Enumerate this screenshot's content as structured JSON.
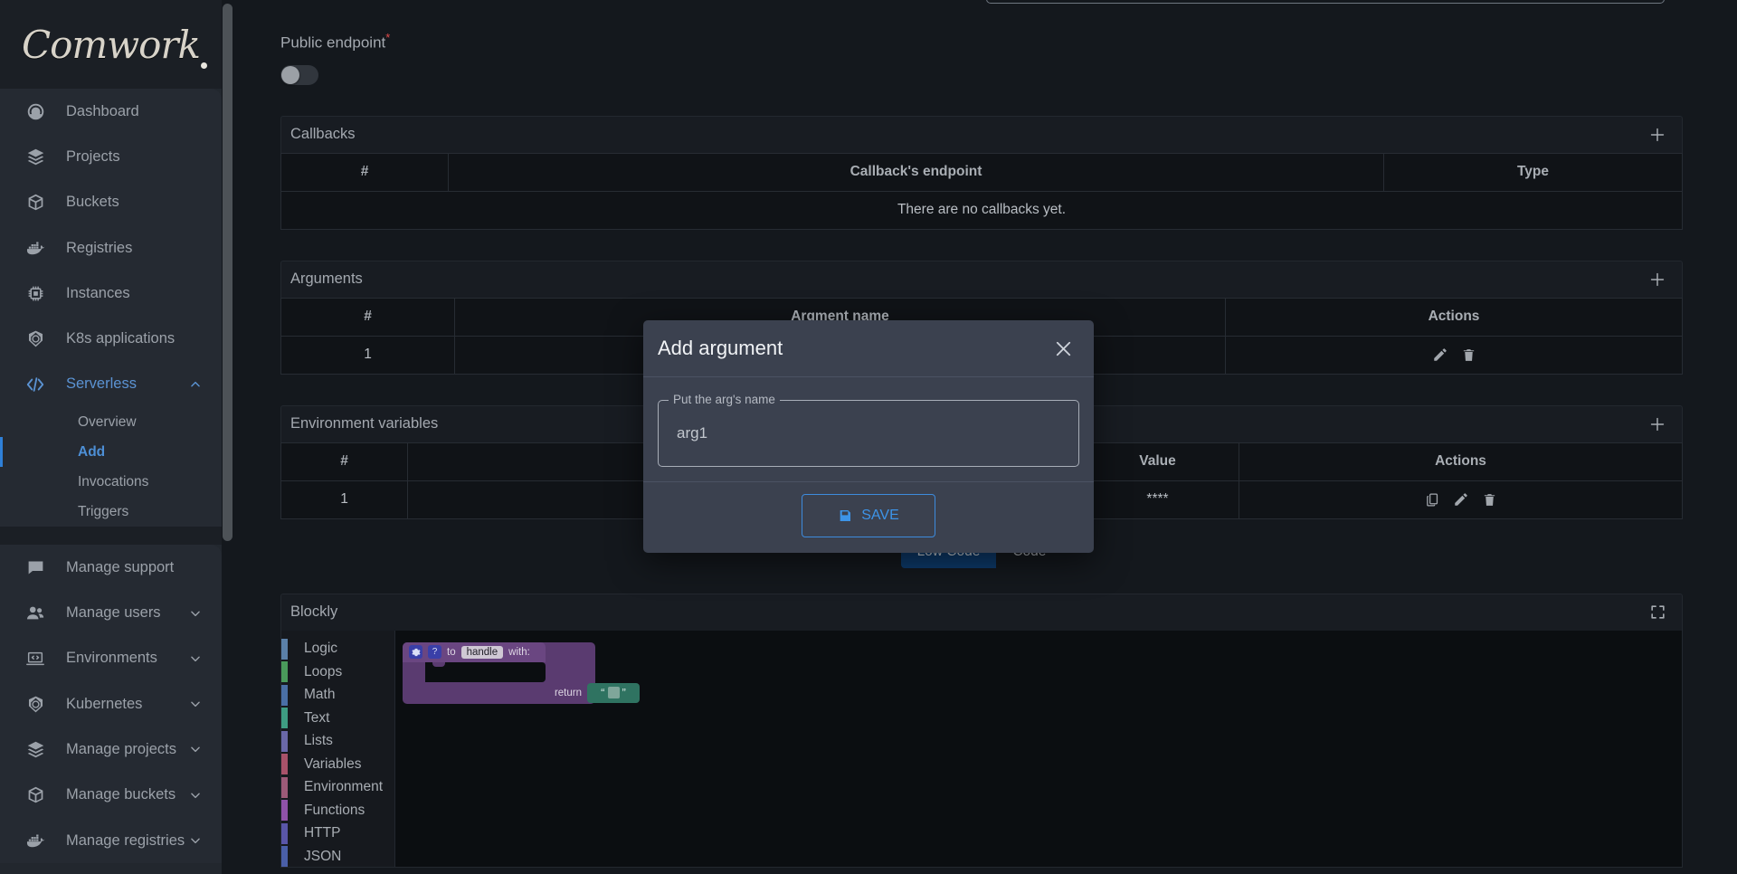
{
  "brand": {
    "name": "Comwork"
  },
  "sidebar": {
    "items": [
      {
        "label": "Dashboard",
        "icon": "gauge-icon",
        "expandable": false,
        "active": false
      },
      {
        "label": "Projects",
        "icon": "layers-icon",
        "expandable": false,
        "active": false
      },
      {
        "label": "Buckets",
        "icon": "box-icon",
        "expandable": false,
        "active": false
      },
      {
        "label": "Registries",
        "icon": "docker-icon",
        "expandable": false,
        "active": false
      },
      {
        "label": "Instances",
        "icon": "cpu-icon",
        "expandable": false,
        "active": false
      },
      {
        "label": "K8s applications",
        "icon": "kubernetes-icon",
        "expandable": false,
        "active": false
      },
      {
        "label": "Serverless",
        "icon": "code-icon",
        "expandable": true,
        "active": true,
        "expanded": true
      }
    ],
    "serverless_children": [
      {
        "label": "Overview",
        "current": false
      },
      {
        "label": "Add",
        "current": true
      },
      {
        "label": "Invocations",
        "current": false
      },
      {
        "label": "Triggers",
        "current": false
      }
    ],
    "manage_items": [
      {
        "label": "Manage support",
        "icon": "chat-icon",
        "expandable": false
      },
      {
        "label": "Manage users",
        "icon": "users-icon",
        "expandable": true
      },
      {
        "label": "Environments",
        "icon": "laptop-code-icon",
        "expandable": true
      },
      {
        "label": "Kubernetes",
        "icon": "kubernetes-icon",
        "expandable": true
      },
      {
        "label": "Manage projects",
        "icon": "layers-icon",
        "expandable": true
      },
      {
        "label": "Manage buckets",
        "icon": "box-icon",
        "expandable": true
      },
      {
        "label": "Manage registries",
        "icon": "docker-icon",
        "expandable": true
      }
    ]
  },
  "form": {
    "public_endpoint_label": "Public endpoint",
    "public_endpoint_required_mark": "*",
    "public_endpoint_value": "off"
  },
  "callbacks": {
    "title": "Callbacks",
    "add_icon": "plus-icon",
    "columns": [
      "#",
      "Callback's endpoint",
      "Type"
    ],
    "empty_message": "There are no callbacks yet."
  },
  "arguments": {
    "title": "Arguments",
    "add_icon": "plus-icon",
    "columns": [
      "#",
      "Argment name",
      "Actions"
    ],
    "rows": [
      {
        "index": "1",
        "name": "",
        "actions": [
          "edit-icon",
          "delete-icon"
        ]
      }
    ]
  },
  "environment_variables": {
    "title": "Environment variables",
    "add_icon": "plus-icon",
    "columns": [
      "#",
      "",
      "Value",
      "Actions"
    ],
    "rows": [
      {
        "index": "1",
        "name": "",
        "value": "****",
        "actions": [
          "copy-icon",
          "edit-icon",
          "delete-icon"
        ]
      }
    ]
  },
  "code_toggle": {
    "options": [
      "Low Code",
      "Code"
    ],
    "selected": "Low Code"
  },
  "blockly": {
    "title": "Blockly",
    "fullscreen_icon": "fullscreen-icon",
    "toolbox": [
      {
        "label": "Logic",
        "color": "#5b80a8"
      },
      {
        "label": "Loops",
        "color": "#4a9a5b"
      },
      {
        "label": "Math",
        "color": "#4a6fa5"
      },
      {
        "label": "Text",
        "color": "#3e9c82"
      },
      {
        "label": "Lists",
        "color": "#6a68a8"
      },
      {
        "label": "Variables",
        "color": "#a8526a"
      },
      {
        "label": "Environment",
        "color": "#9c5a78"
      },
      {
        "label": "Functions",
        "color": "#8f52a8"
      },
      {
        "label": "HTTP",
        "color": "#5a56a8"
      },
      {
        "label": "JSON",
        "color": "#4a5fa8"
      }
    ],
    "workspace_block": {
      "settings_icon": "gear-icon",
      "help_icon": "help-icon",
      "prefix": "to",
      "function_name": "handle",
      "suffix": "with:",
      "return_label": "return",
      "string_open_quote": "“",
      "string_close_quote": "”"
    }
  },
  "modal": {
    "title": "Add argument",
    "close_icon": "close-icon",
    "field_legend": "Put the arg's name",
    "field_value": "arg1",
    "save_label": "SAVE",
    "save_icon": "save-icon"
  },
  "colors": {
    "accent_blue": "#3d94e8",
    "modal_bg": "#3b414f",
    "sidebar_bg": "#252a32",
    "page_bg": "#14181d",
    "required_red": "#e04a4a"
  }
}
